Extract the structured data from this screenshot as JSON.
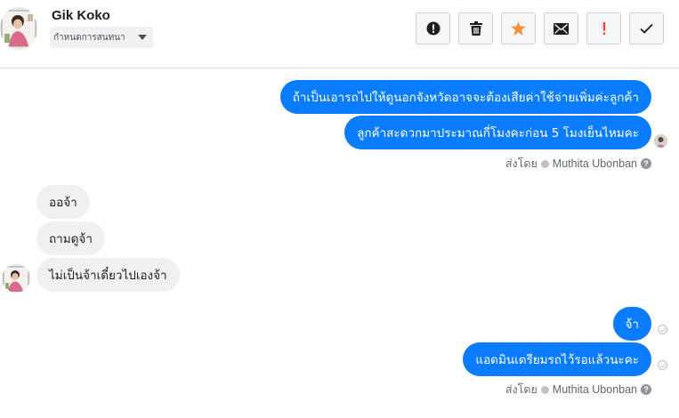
{
  "header": {
    "contact_name": "Gik Koko",
    "conversation_menu_label": "กำหนดการสนทนา"
  },
  "toolbar": {
    "buttons": [
      {
        "name": "spam-button",
        "icon": "alert-circle-icon",
        "color": "#1c1e21"
      },
      {
        "name": "delete-button",
        "icon": "trash-icon",
        "color": "#1c1e21"
      },
      {
        "name": "star-button",
        "icon": "star-icon",
        "color": "#f7923b"
      },
      {
        "name": "mark-unread-button",
        "icon": "envelope-icon",
        "color": "#1c1e21"
      },
      {
        "name": "important-button",
        "icon": "exclamation-icon",
        "color": "#fa3e3e"
      },
      {
        "name": "done-button",
        "icon": "checkmark-icon",
        "color": "#1c1e21"
      }
    ]
  },
  "messages": [
    {
      "side": "out",
      "text": "ถ้าเป็นเอารถไปให้ดูนอกจังหวัดอาจจะต้องเสียค่าใช้จ่ายเพิ่มค่ะลูกค้า"
    },
    {
      "side": "out",
      "text": "ลูกค้าสะดวกมาประมาณกี่โมงคะก่อน 5 โมงเย็นไหมคะ"
    },
    {
      "side": "in",
      "text": "ออจ้า"
    },
    {
      "side": "in",
      "text": "ถามดูจ้า"
    },
    {
      "side": "in",
      "text": "ไม่เป็นจ้าเดี๋ยวไปเองจ้า"
    },
    {
      "side": "out",
      "text": "จ้า"
    },
    {
      "side": "out",
      "text": "แอดมินเตรียมรถไว้รอแล้วนะคะ"
    }
  ],
  "sent_by": {
    "prefix": "ส่งโดย",
    "name": "Muthita Ubonban"
  },
  "colors": {
    "outgoing_bubble": "#0a7cff",
    "incoming_bubble": "#f1f0f0"
  }
}
